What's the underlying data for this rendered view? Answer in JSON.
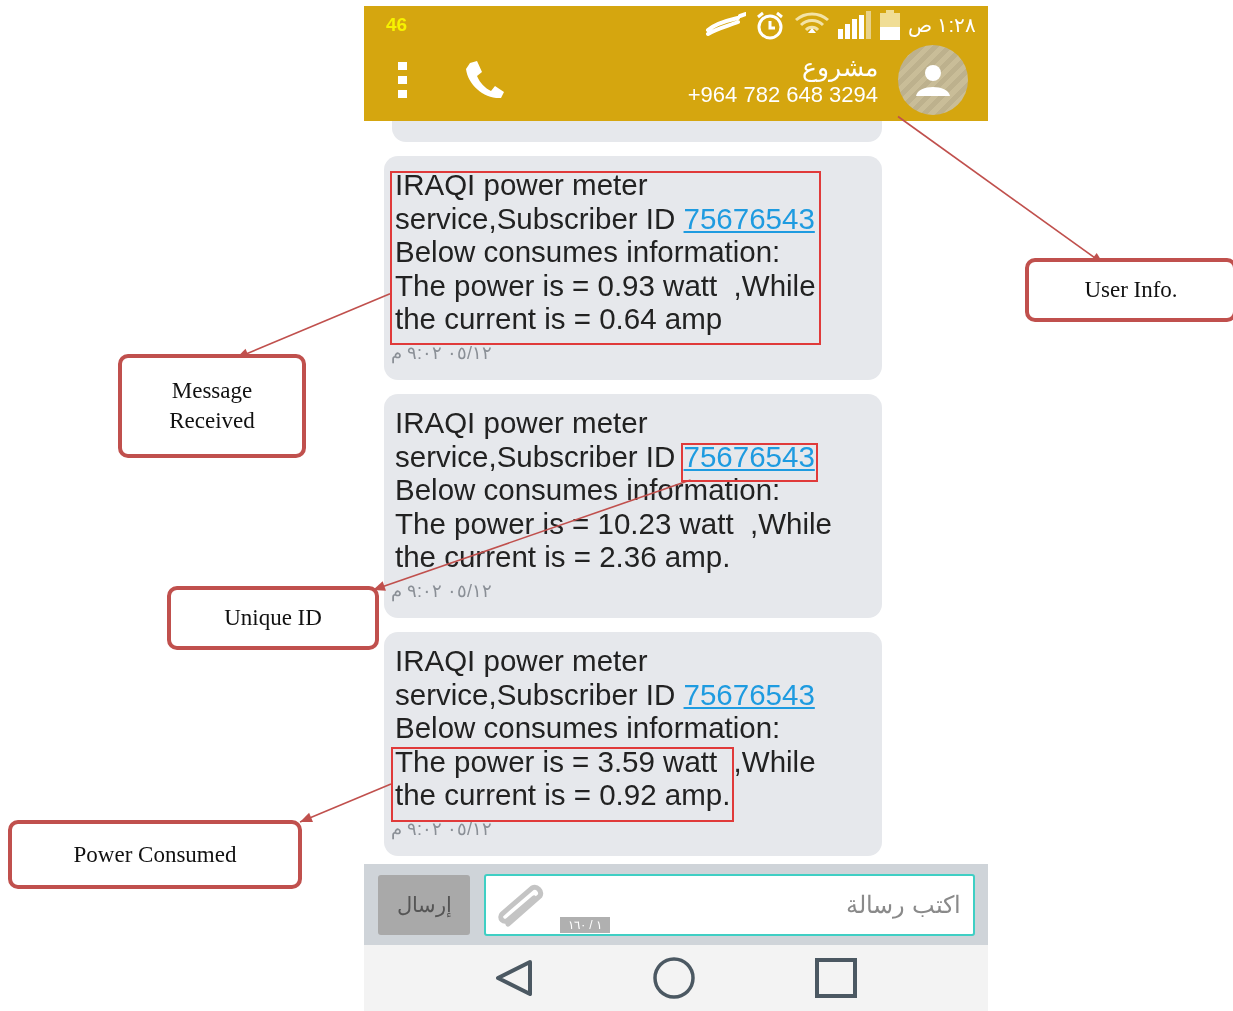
{
  "status_bar": {
    "network": "46",
    "time": "١:٢٨ ص"
  },
  "header": {
    "contact_name": "مشروع",
    "phone_number": "+964 782 648 3294"
  },
  "messages": [
    {
      "intro": [
        "IRAQI power meter",
        "service,Subscriber ID"
      ],
      "subscriber_id": "75676543",
      "info": "Below consumes information:",
      "power": "The power is = 0.93 watt",
      "power_tail": "  ,While",
      "current": "the current is = 0.64 amp",
      "timestamp": "٠٥/١٢ ٩:٠٢ م",
      "text_highlighted": true,
      "id_highlighted": false,
      "power_highlighted": false
    },
    {
      "intro": [
        "IRAQI power meter",
        "service,Subscriber ID"
      ],
      "subscriber_id": "75676543",
      "info": "Below consumes information:",
      "power": "The power is = 10.23 watt",
      "power_tail": "  ,While",
      "current": "the current is = 2.36 amp.",
      "timestamp": "٠٥/١٢ ٩:٠٢ م",
      "text_highlighted": false,
      "id_highlighted": true,
      "power_highlighted": false
    },
    {
      "intro": [
        "IRAQI power meter",
        "service,Subscriber ID"
      ],
      "subscriber_id": "75676543",
      "info": "Below consumes information:",
      "power": "The power is = 3.59 watt",
      "power_tail": "  ,While",
      "current": "the current is = 0.92 amp.",
      "timestamp": "٠٥/١٢ ٩:٠٢ م",
      "text_highlighted": false,
      "id_highlighted": false,
      "power_highlighted": true
    }
  ],
  "composer": {
    "send_label": "إرسال",
    "placeholder": "اكتب رسالة",
    "counter": "١ / ١٦٠"
  },
  "annotations": [
    {
      "label": "User Info.",
      "kind": "avatar"
    },
    {
      "label": "Message Received",
      "kind": "text"
    },
    {
      "label": "Unique ID",
      "kind": "id"
    },
    {
      "label": "Power Consumed",
      "kind": "power"
    }
  ]
}
